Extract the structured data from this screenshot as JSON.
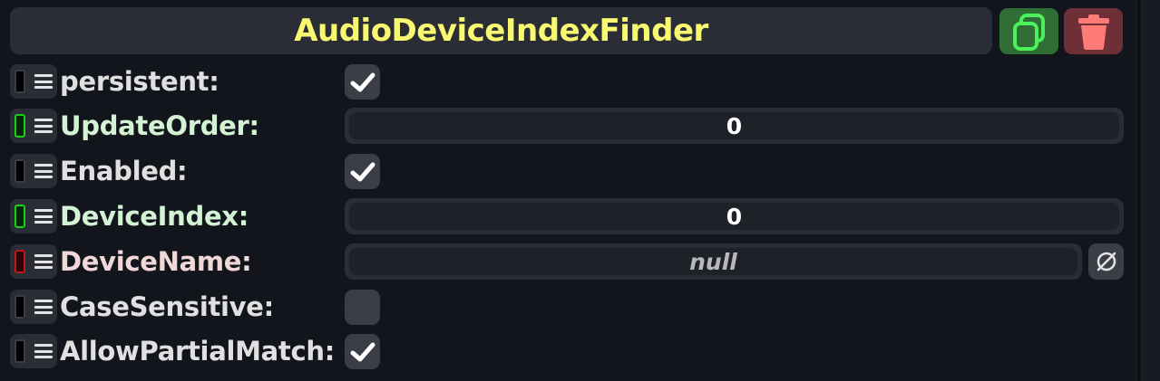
{
  "component": {
    "title": "AudioDeviceIndexFinder",
    "duplicate_icon": "duplicate-icon",
    "delete_icon": "trash-icon"
  },
  "fields": [
    {
      "label": "persistent:",
      "type": "checkbox",
      "checked": true,
      "indicator": "none"
    },
    {
      "label": "UpdateOrder:",
      "type": "number",
      "value": "0",
      "indicator": "green"
    },
    {
      "label": "Enabled:",
      "type": "checkbox",
      "checked": true,
      "indicator": "none"
    },
    {
      "label": "DeviceIndex:",
      "type": "number",
      "value": "0",
      "indicator": "green"
    },
    {
      "label": "DeviceName:",
      "type": "text",
      "value": "null",
      "indicator": "red",
      "clear_icon": "null-icon"
    },
    {
      "label": "CaseSensitive:",
      "type": "checkbox",
      "checked": false,
      "indicator": "none"
    },
    {
      "label": "AllowPartialMatch:",
      "type": "checkbox",
      "checked": true,
      "indicator": "none"
    }
  ],
  "colors": {
    "title": "#f9f871",
    "duplicate_bg": "#2f6e35",
    "duplicate_fg": "#4cf05c",
    "delete_bg": "#6e2f37",
    "delete_fg": "#ff7b78",
    "linked_green": "#18d018",
    "linked_red": "#c01818"
  }
}
